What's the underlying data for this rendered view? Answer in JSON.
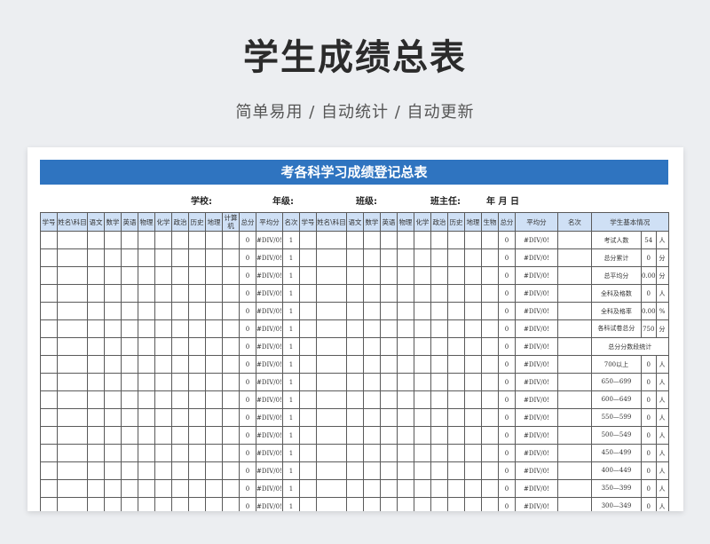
{
  "title": "学生成绩总表",
  "subtitle": "简单易用  /  自动统计  /  自动更新",
  "sheet": {
    "banner": "考各科学习成绩登记总表",
    "info": {
      "school": "学校:",
      "grade": "年级:",
      "class": "班级:",
      "head_teacher": "班主任:",
      "date": "年  月  日"
    },
    "headers_left": [
      "学号",
      "姓名\\科目",
      "语文",
      "数学",
      "英语",
      "物理",
      "化学",
      "政治",
      "历史",
      "地理",
      "计算机",
      "总分",
      "平均分",
      "名次"
    ],
    "headers_right": [
      "学号",
      "姓名\\科目",
      "语文",
      "数学",
      "英语",
      "物理",
      "化学",
      "政治",
      "历史",
      "地理",
      "生物",
      "总分",
      "平均分",
      "名次"
    ],
    "stats_header": "学生基本情况",
    "row_values": {
      "total": "0",
      "avg": "#DIV/0!",
      "rank": "1"
    },
    "stats": [
      {
        "label": "考试人数",
        "value": "54",
        "unit": "人"
      },
      {
        "label": "总分累计",
        "value": "0",
        "unit": "分"
      },
      {
        "label": "总平均分",
        "value": "0.00",
        "unit": "分"
      },
      {
        "label": "全科及格数",
        "value": "0",
        "unit": "人"
      },
      {
        "label": "全科及格率",
        "value": "0.00",
        "unit": "%"
      },
      {
        "label": "各科试卷总分",
        "value": "750",
        "unit": "分"
      },
      {
        "label": "总分分数段统计",
        "value": "",
        "unit": ""
      },
      {
        "label": "700以上",
        "value": "0",
        "unit": "人"
      },
      {
        "label": "650—699",
        "value": "0",
        "unit": "人"
      },
      {
        "label": "600—649",
        "value": "0",
        "unit": "人"
      },
      {
        "label": "550—599",
        "value": "0",
        "unit": "人"
      },
      {
        "label": "500—549",
        "value": "0",
        "unit": "人"
      },
      {
        "label": "450—499",
        "value": "0",
        "unit": "人"
      },
      {
        "label": "400—449",
        "value": "0",
        "unit": "人"
      },
      {
        "label": "350—399",
        "value": "0",
        "unit": "人"
      },
      {
        "label": "300—349",
        "value": "0",
        "unit": "人"
      }
    ]
  }
}
